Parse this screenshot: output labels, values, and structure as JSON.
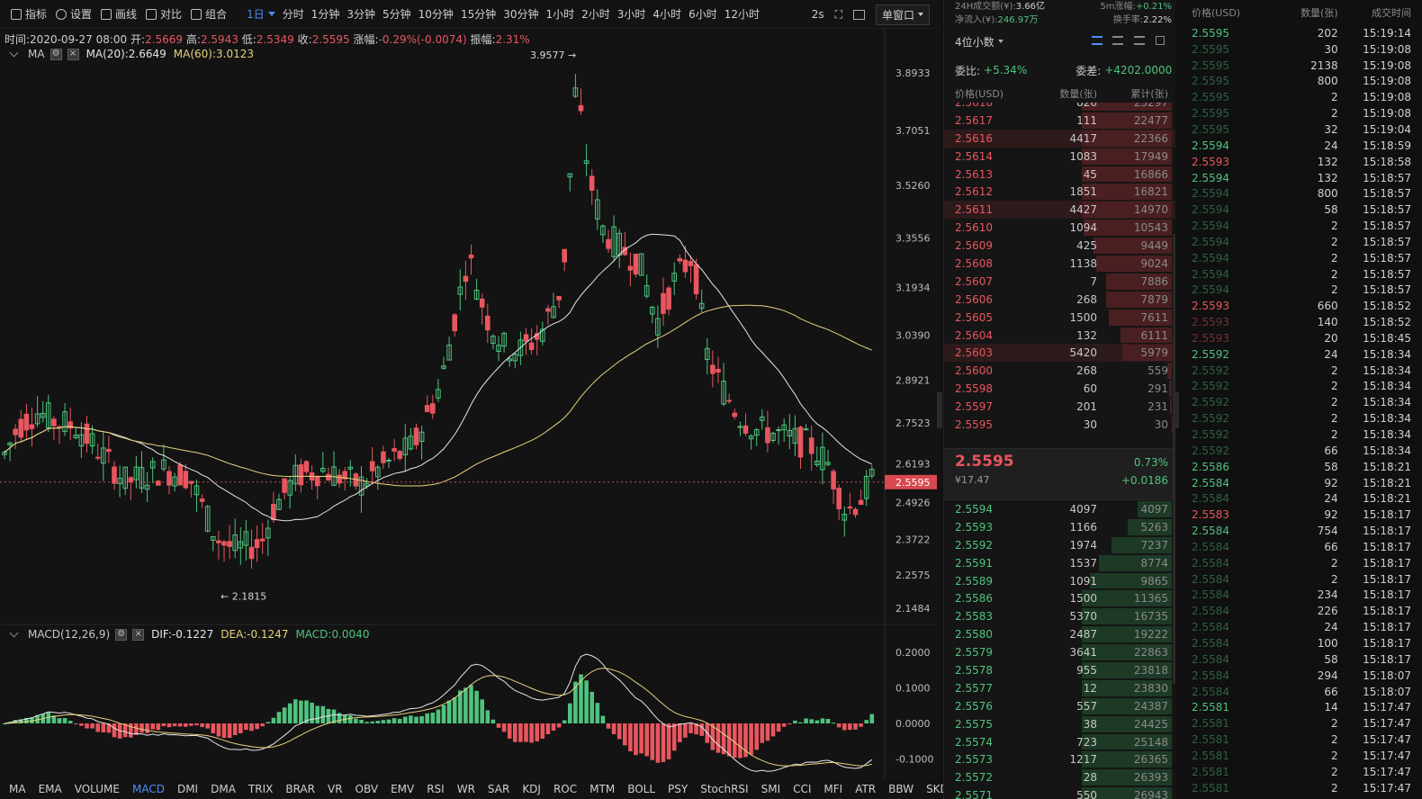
{
  "toolbar": {
    "tools": [
      {
        "label": "指标",
        "icon": "indicator-icon"
      },
      {
        "label": "设置",
        "icon": "gear-icon"
      },
      {
        "label": "画线",
        "icon": "pencil-icon"
      },
      {
        "label": "对比",
        "icon": "compare-icon"
      },
      {
        "label": "组合",
        "icon": "combine-icon"
      }
    ],
    "active_interval": "1日",
    "intervals": [
      "分时",
      "1分钟",
      "3分钟",
      "5分钟",
      "10分钟",
      "15分钟",
      "30分钟",
      "1小时",
      "2小时",
      "3小时",
      "4小时",
      "6小时",
      "12小时"
    ],
    "refresh": "2s",
    "window_mode": "单窗口"
  },
  "ohlc": {
    "time_label": "时间:",
    "time": "2020-09-27 08:00",
    "open_label": "开:",
    "open": "2.5669",
    "high_label": "高:",
    "high": "2.5943",
    "low_label": "低:",
    "low": "2.5349",
    "close_label": "收:",
    "close": "2.5595",
    "change_label": "涨幅:",
    "change": "-0.29%(-0.0074)",
    "amplitude_label": "振幅:",
    "amplitude": "2.31%"
  },
  "ma_legend": {
    "name": "MA",
    "ma20": "MA(20):2.6649",
    "ma60": "MA(60):3.0123"
  },
  "macd_legend": {
    "name": "MACD(12,26,9)",
    "dif": "DIF:-0.1227",
    "dea": "DEA:-0.1247",
    "macd": "MACD:0.0040"
  },
  "chart_data": {
    "type": "candlestick",
    "price_axis": [
      "3.8933",
      "3.7051",
      "3.5260",
      "3.3556",
      "3.1934",
      "3.0390",
      "2.8921",
      "2.7523",
      "2.6193",
      "2.4926",
      "2.3722",
      "2.2575",
      "2.1484"
    ],
    "macd_axis": [
      "0.2000",
      "0.1000",
      "0.0000",
      "-0.1000"
    ],
    "current_price": "2.5595",
    "max_marker": "3.9577",
    "min_marker": "2.1815",
    "colors": {
      "up": "#4fc37e",
      "down": "#e8565f",
      "ma20": "#e6e6e6",
      "ma60": "#e7d27b"
    }
  },
  "indicator_tabs": [
    "MA",
    "EMA",
    "VOLUME",
    "MACD",
    "DMI",
    "DMA",
    "TRIX",
    "BRAR",
    "VR",
    "OBV",
    "EMV",
    "RSI",
    "WR",
    "SAR",
    "KDJ",
    "ROC",
    "MTM",
    "BOLL",
    "PSY",
    "StochRSI",
    "SMI",
    "CCI",
    "MFI",
    "ATR",
    "BBW",
    "SKDJ",
    "BIAS"
  ],
  "active_indicator": "MACD",
  "stats": {
    "vol_label": "24H成交额(¥):",
    "vol": "3.66亿",
    "inflow_label": "净流入(¥):",
    "inflow": "246.97万",
    "m5_label": "5m涨幅:",
    "m5": "+0.21%",
    "turnover_label": "换手率:",
    "turnover": "2.22%"
  },
  "orderbook": {
    "precision": "4位小数",
    "ratio_label": "委比:",
    "ratio": "+5.34%",
    "diff_label": "委差:",
    "diff": "+4202.0000",
    "headers": [
      "价格(USD)",
      "数量(张)",
      "累计(张)"
    ],
    "asks": [
      [
        "2.5618",
        "826",
        "23297"
      ],
      [
        "2.5617",
        "111",
        "22477"
      ],
      [
        "2.5616",
        "4417",
        "22366"
      ],
      [
        "2.5614",
        "1083",
        "17949"
      ],
      [
        "2.5613",
        "45",
        "16866"
      ],
      [
        "2.5612",
        "1851",
        "16821"
      ],
      [
        "2.5611",
        "4427",
        "14970"
      ],
      [
        "2.5610",
        "1094",
        "10543"
      ],
      [
        "2.5609",
        "425",
        "9449"
      ],
      [
        "2.5608",
        "1138",
        "9024"
      ],
      [
        "2.5607",
        "7",
        "7886"
      ],
      [
        "2.5606",
        "268",
        "7879"
      ],
      [
        "2.5605",
        "1500",
        "7611"
      ],
      [
        "2.5604",
        "132",
        "6111"
      ],
      [
        "2.5603",
        "5420",
        "5979"
      ],
      [
        "2.5600",
        "268",
        "559"
      ],
      [
        "2.5598",
        "60",
        "291"
      ],
      [
        "2.5597",
        "201",
        "231"
      ],
      [
        "2.5595",
        "30",
        "30"
      ]
    ],
    "last_price": "2.5595",
    "last_price_cny": "¥17.47",
    "last_pct": "0.73%",
    "last_change": "+0.0186",
    "bids": [
      [
        "2.5594",
        "4097",
        "4097"
      ],
      [
        "2.5593",
        "1166",
        "5263"
      ],
      [
        "2.5592",
        "1974",
        "7237"
      ],
      [
        "2.5591",
        "1537",
        "8774"
      ],
      [
        "2.5589",
        "1091",
        "9865"
      ],
      [
        "2.5586",
        "1500",
        "11365"
      ],
      [
        "2.5583",
        "5370",
        "16735"
      ],
      [
        "2.5580",
        "2487",
        "19222"
      ],
      [
        "2.5579",
        "3641",
        "22863"
      ],
      [
        "2.5578",
        "955",
        "23818"
      ],
      [
        "2.5577",
        "12",
        "23830"
      ],
      [
        "2.5576",
        "557",
        "24387"
      ],
      [
        "2.5575",
        "38",
        "24425"
      ],
      [
        "2.5574",
        "723",
        "25148"
      ],
      [
        "2.5573",
        "1217",
        "26365"
      ],
      [
        "2.5572",
        "28",
        "26393"
      ],
      [
        "2.5571",
        "550",
        "26943"
      ]
    ]
  },
  "trades": {
    "headers": [
      "价格(USD)",
      "数量(张)",
      "成交时间"
    ],
    "rows": [
      [
        "2.5595",
        "202",
        "15:19:14",
        "buy",
        1
      ],
      [
        "2.5595",
        "30",
        "15:19:08",
        "buy",
        0
      ],
      [
        "2.5595",
        "2138",
        "15:19:08",
        "buy",
        0
      ],
      [
        "2.5595",
        "800",
        "15:19:08",
        "buy",
        0
      ],
      [
        "2.5595",
        "2",
        "15:19:08",
        "buy",
        0
      ],
      [
        "2.5595",
        "2",
        "15:19:08",
        "buy",
        0
      ],
      [
        "2.5595",
        "32",
        "15:19:04",
        "buy",
        0
      ],
      [
        "2.5594",
        "24",
        "15:18:59",
        "buy",
        1
      ],
      [
        "2.5593",
        "132",
        "15:18:58",
        "sell",
        1
      ],
      [
        "2.5594",
        "132",
        "15:18:57",
        "buy",
        1
      ],
      [
        "2.5594",
        "800",
        "15:18:57",
        "buy",
        0
      ],
      [
        "2.5594",
        "58",
        "15:18:57",
        "buy",
        0
      ],
      [
        "2.5594",
        "2",
        "15:18:57",
        "buy",
        0
      ],
      [
        "2.5594",
        "2",
        "15:18:57",
        "buy",
        0
      ],
      [
        "2.5594",
        "2",
        "15:18:57",
        "buy",
        0
      ],
      [
        "2.5594",
        "2",
        "15:18:57",
        "buy",
        0
      ],
      [
        "2.5594",
        "2",
        "15:18:57",
        "buy",
        0
      ],
      [
        "2.5593",
        "660",
        "15:18:52",
        "sell",
        1
      ],
      [
        "2.5593",
        "140",
        "15:18:52",
        "sell",
        0
      ],
      [
        "2.5593",
        "20",
        "15:18:45",
        "sell",
        0
      ],
      [
        "2.5592",
        "24",
        "15:18:34",
        "buy",
        1
      ],
      [
        "2.5592",
        "2",
        "15:18:34",
        "buy",
        0
      ],
      [
        "2.5592",
        "2",
        "15:18:34",
        "buy",
        0
      ],
      [
        "2.5592",
        "2",
        "15:18:34",
        "buy",
        0
      ],
      [
        "2.5592",
        "2",
        "15:18:34",
        "buy",
        0
      ],
      [
        "2.5592",
        "2",
        "15:18:34",
        "buy",
        0
      ],
      [
        "2.5592",
        "66",
        "15:18:34",
        "buy",
        0
      ],
      [
        "2.5586",
        "58",
        "15:18:21",
        "buy",
        1
      ],
      [
        "2.5584",
        "92",
        "15:18:21",
        "buy",
        1
      ],
      [
        "2.5584",
        "24",
        "15:18:21",
        "buy",
        0
      ],
      [
        "2.5583",
        "92",
        "15:18:17",
        "sell",
        1
      ],
      [
        "2.5584",
        "754",
        "15:18:17",
        "buy",
        1
      ],
      [
        "2.5584",
        "66",
        "15:18:17",
        "buy",
        0
      ],
      [
        "2.5584",
        "2",
        "15:18:17",
        "buy",
        0
      ],
      [
        "2.5584",
        "2",
        "15:18:17",
        "buy",
        0
      ],
      [
        "2.5584",
        "234",
        "15:18:17",
        "buy",
        0
      ],
      [
        "2.5584",
        "226",
        "15:18:17",
        "buy",
        0
      ],
      [
        "2.5584",
        "24",
        "15:18:17",
        "buy",
        0
      ],
      [
        "2.5584",
        "100",
        "15:18:17",
        "buy",
        0
      ],
      [
        "2.5584",
        "58",
        "15:18:17",
        "buy",
        0
      ],
      [
        "2.5584",
        "294",
        "15:18:07",
        "buy",
        0
      ],
      [
        "2.5584",
        "66",
        "15:18:07",
        "buy",
        0
      ],
      [
        "2.5581",
        "14",
        "15:17:47",
        "buy",
        1
      ],
      [
        "2.5581",
        "2",
        "15:17:47",
        "buy",
        0
      ],
      [
        "2.5581",
        "2",
        "15:17:47",
        "buy",
        0
      ],
      [
        "2.5581",
        "2",
        "15:17:47",
        "buy",
        0
      ],
      [
        "2.5581",
        "2",
        "15:17:47",
        "buy",
        0
      ],
      [
        "2.5581",
        "2",
        "15:17:47",
        "buy",
        0
      ]
    ]
  }
}
